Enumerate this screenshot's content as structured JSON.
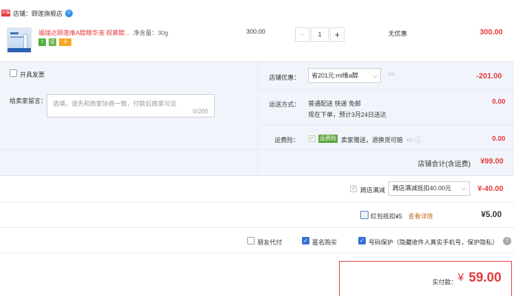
{
  "store": {
    "badge": "天猫",
    "label": "店铺：颐莲旗舰店",
    "ww": "小"
  },
  "item": {
    "title": "福瑞达颐莲维A醇精华液 视黄醇...",
    "spec": "净含量：30g",
    "unit_price": "300.00",
    "quantity": "1",
    "qty_minus": "−",
    "qty_plus": "+",
    "discount": "无优惠",
    "total": "300.00",
    "service_icons": [
      "7",
      "证",
      "卡"
    ]
  },
  "invoice": {
    "label": "开具发票"
  },
  "shop_discount": {
    "label": "店铺优惠：",
    "selected": "省201元:ml维a醇",
    "value": "-201.00"
  },
  "message": {
    "label": "给卖家留言：",
    "placeholder": "选填，请先和商家协商一致，付款后商家可见",
    "count": "0/200"
  },
  "shipping": {
    "label": "运送方式：",
    "line1": "普通配送 快递 免邮",
    "line2": "现在下单，预计3月24日送达",
    "value": "0.00"
  },
  "insurance": {
    "label": "运费险：",
    "badge": "运费险",
    "text": "卖家赠送，退换货可赔",
    "value": "0.00"
  },
  "shop_total": {
    "label": "店铺合计(含运费)",
    "value": "¥99.00"
  },
  "cross_store": {
    "label": "跨店满减",
    "selected": "跨店满减抵扣40.00元",
    "value": "¥-40.00"
  },
  "red_packet": {
    "label": "红包抵扣¥5",
    "link": "查看详情",
    "value": "¥5.00"
  },
  "options": {
    "friend": "朋友代付",
    "anonymous": "匿名购买",
    "privacy": "号码保护（隐藏收件人真实手机号，保护隐私）",
    "help": "?"
  },
  "payment": {
    "label": "实付款：",
    "currency": "¥",
    "amount": "59.00"
  },
  "colors": {
    "accent_red": "#e4393c",
    "panel_bg": "#f1f5fb",
    "check_blue": "#3b6fd6"
  }
}
